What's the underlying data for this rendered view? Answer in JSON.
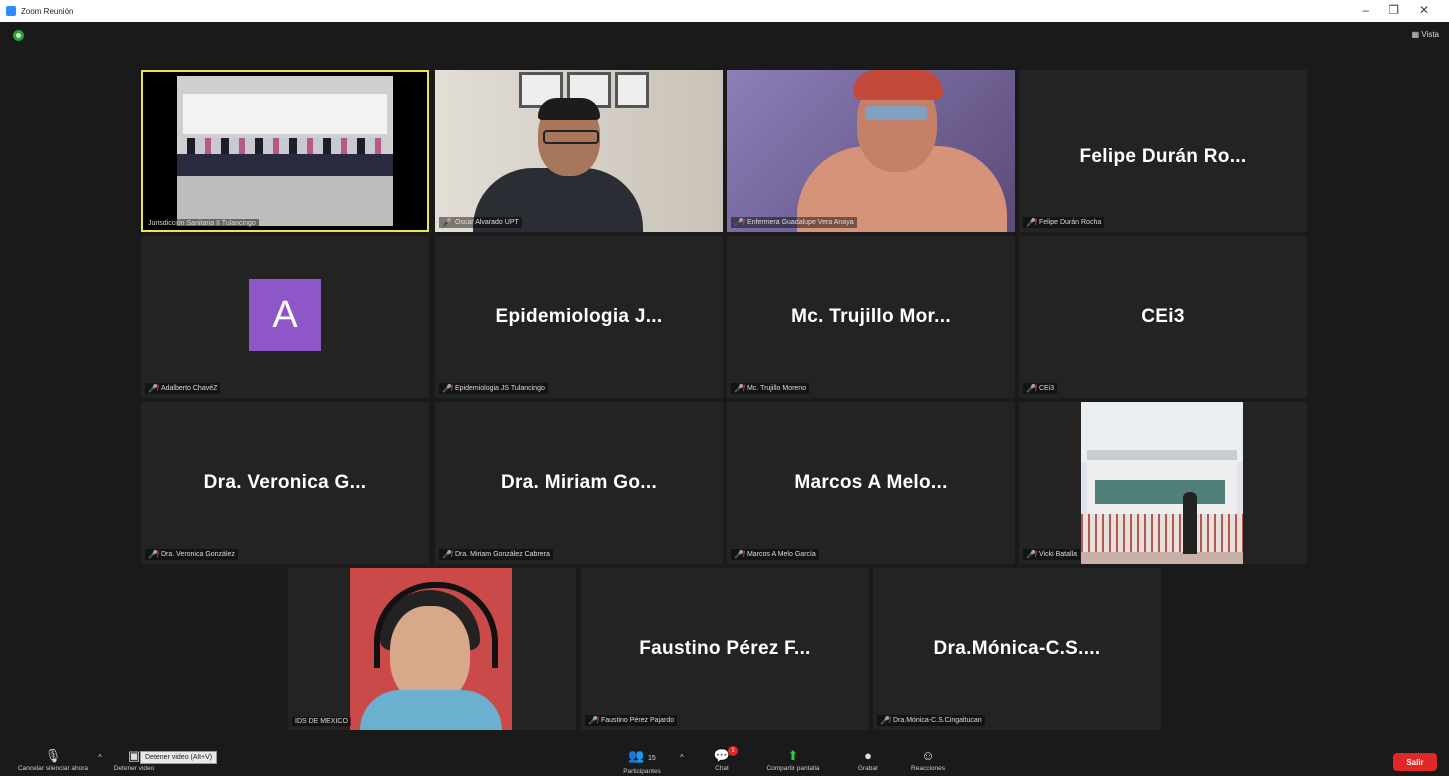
{
  "window": {
    "title": "Zoom Reunión",
    "minimize": "–",
    "restore": "❐",
    "close": "✕"
  },
  "view_button": "Vista",
  "tiles": [
    {
      "label": "Jurisdicción Sanitaria II Tulancingo",
      "big": "",
      "type": "video-conf",
      "muted": false
    },
    {
      "label": "Oscar Alvarado UPT",
      "big": "",
      "type": "video-office",
      "muted": true
    },
    {
      "label": "Enfermera Guadalupe Vera Anaya",
      "big": "",
      "type": "video-woman",
      "muted": true
    },
    {
      "label": "Felipe Durán Rocha",
      "big": "Felipe Durán Ro...",
      "type": "name",
      "muted": true
    },
    {
      "label": "Adalberto ChavéZ",
      "big": "",
      "type": "avatar",
      "avatar_letter": "A",
      "muted": true
    },
    {
      "label": "Epidemiologia JS Tulancingo",
      "big": "Epidemiologia J...",
      "type": "name",
      "muted": true
    },
    {
      "label": "Mc. Trujillo Moreno",
      "big": "Mc. Trujillo Mor...",
      "type": "name",
      "muted": true
    },
    {
      "label": "CEi3",
      "big": "CEi3",
      "type": "name",
      "muted": true
    },
    {
      "label": "Dra. Veronica González",
      "big": "Dra. Veronica G...",
      "type": "name",
      "muted": true
    },
    {
      "label": "Dra. Miriam González Cabrera",
      "big": "Dra. Miriam Go...",
      "type": "name",
      "muted": true
    },
    {
      "label": "Marcos A Melo García",
      "big": "Marcos A Melo...",
      "type": "name",
      "muted": true
    },
    {
      "label": "Vicki Batalla",
      "big": "",
      "type": "photo-bldg",
      "muted": true
    },
    {
      "label": "IDS DE MEXICO",
      "big": "",
      "type": "photo-radio",
      "muted": false
    },
    {
      "label": "Faustino Pérez Pajardo",
      "big": "Faustino Pérez F...",
      "type": "name",
      "muted": true
    },
    {
      "label": "Dra.Mónica-C.S.Cingaltucan",
      "big": "Dra.Mónica-C.S....",
      "type": "name",
      "muted": true
    }
  ],
  "toolbar": {
    "mute": "Cancelar silenciar ahora",
    "stop_video": "Detener video",
    "tooltip": "Detener video (Alt+V)",
    "participants": "Participantes",
    "participants_count": "15",
    "chat": "Chat",
    "chat_badge": "1",
    "share": "Compartir pantalla",
    "record": "Grabar",
    "reactions": "Reacciones",
    "leave": "Salir"
  },
  "colors": {
    "active_speaker_border": "#e7e35a",
    "muted_icon": "#e0423d",
    "share_green": "#1fd04a",
    "leave_red": "#e02828",
    "avatar_purple": "#8e57c7"
  }
}
